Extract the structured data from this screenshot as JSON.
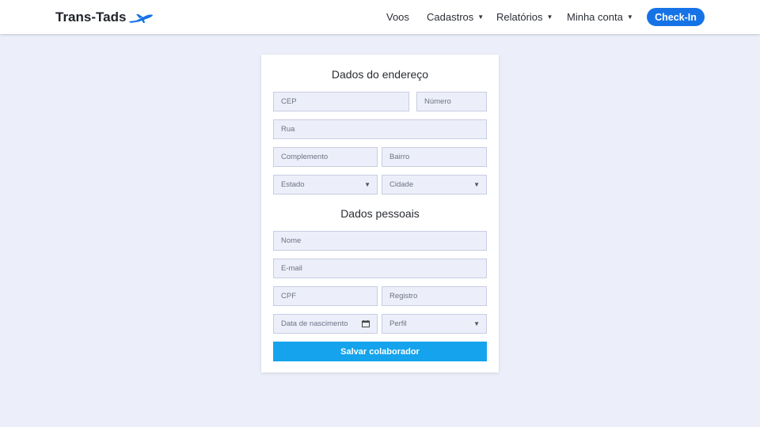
{
  "brand": {
    "name": "Trans-Tads",
    "logo_icon": "airplane-icon",
    "accent": "#1673e6"
  },
  "nav": {
    "items": [
      {
        "label": "Voos",
        "dropdown": false
      },
      {
        "label": "Cadastros",
        "dropdown": true
      },
      {
        "label": "Relatórios",
        "dropdown": true
      },
      {
        "label": "Minha conta",
        "dropdown": true
      }
    ],
    "checkin_label": "Check-In"
  },
  "form": {
    "address_title": "Dados do endereço",
    "personal_title": "Dados pessoais",
    "fields": {
      "cep": "CEP",
      "numero": "Número",
      "rua": "Rua",
      "complemento": "Complemento",
      "bairro": "Bairro",
      "estado": "Estado",
      "cidade": "Cidade",
      "nome": "Nome",
      "email": "E-mail",
      "cpf": "CPF",
      "registro": "Registro",
      "nascimento": "Data de nascimento",
      "perfil": "Perfil"
    },
    "submit_label": "Salvar colaborador",
    "submit_color": "#14a3ec"
  }
}
